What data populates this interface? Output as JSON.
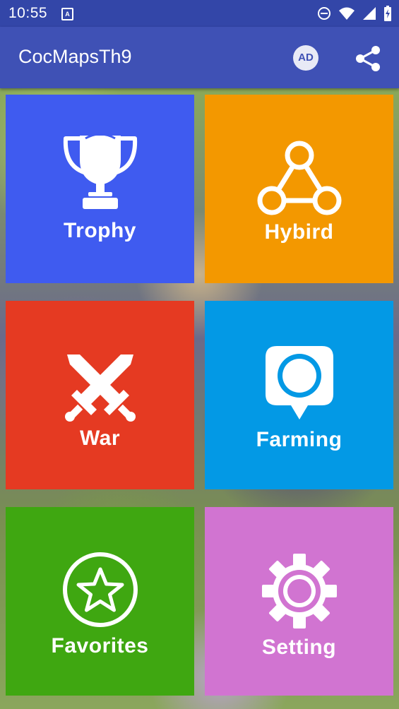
{
  "status_bar": {
    "time": "10:55",
    "notification_icon_letter": "A",
    "icons": [
      "a-notification-icon",
      "dnd-icon",
      "wifi-icon",
      "signal-icon",
      "battery-icon"
    ]
  },
  "app_bar": {
    "title": "CocMapsTh9",
    "ad_label": "AD",
    "share_icon": "share-icon"
  },
  "colors": {
    "status_bar": "#3346a8",
    "app_bar": "#3f51b5",
    "trophy": "#3f5bf0",
    "hybird": "#f39800",
    "war": "#e53a22",
    "farming": "#0399e5",
    "favorites": "#3fa711",
    "setting": "#d174d1"
  },
  "menu": {
    "trophy": {
      "label": "Trophy",
      "icon": "trophy-icon"
    },
    "hybird": {
      "label": "Hybird",
      "icon": "hybrid-network-icon"
    },
    "war": {
      "label": "War",
      "icon": "crossed-swords-icon"
    },
    "farming": {
      "label": "Farming",
      "icon": "map-pin-icon"
    },
    "favorites": {
      "label": "Favorites",
      "icon": "star-icon"
    },
    "setting": {
      "label": "Setting",
      "icon": "gear-icon"
    }
  }
}
